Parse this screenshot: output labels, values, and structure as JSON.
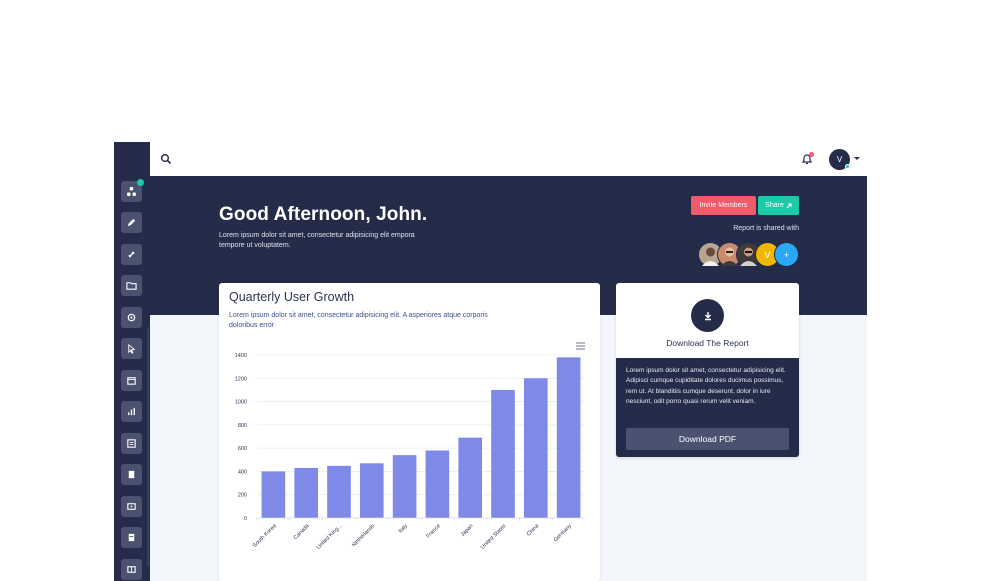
{
  "header": {
    "user_initial": "V"
  },
  "hero": {
    "greeting": "Good Afternoon, John.",
    "subtitle": "Lorem ipsum dolor sit amet, consectetur adipisicing elit empora tempore ut voluptatem.",
    "invite_label": "Invite Members",
    "share_label": "Share",
    "shared_with_label": "Report is shared with",
    "shared_avatars": [
      {
        "type": "photo",
        "color": "#b9a58f"
      },
      {
        "type": "photo",
        "color": "#c98b6e"
      },
      {
        "type": "photo",
        "color": "#3e3a3a"
      },
      {
        "type": "initial",
        "label": "V",
        "color": "#f2b705"
      },
      {
        "type": "add",
        "label": "+",
        "color": "#2aa7f5"
      }
    ]
  },
  "growth_card": {
    "title": "Quarterly User Growth",
    "subtitle": "Lorem ipsum dolor sit amet, consectetur adipisicing elit. A asperiores atque corporis doloribus error"
  },
  "chart_data": {
    "type": "bar",
    "categories": [
      "South Korea",
      "Canada",
      "United Kingdom",
      "Netherlands",
      "Italy",
      "France",
      "Japan",
      "United States",
      "China",
      "Germany"
    ],
    "category_labels": [
      "South Korea",
      "Canada",
      "United King...",
      "Netherlands",
      "Italy",
      "France",
      "Japan",
      "United States",
      "China",
      "Germany"
    ],
    "values": [
      400,
      430,
      448,
      470,
      540,
      580,
      690,
      1100,
      1200,
      1380
    ],
    "yticks": [
      0,
      200,
      400,
      600,
      800,
      1000,
      1200,
      1400
    ],
    "ylim": [
      0,
      1400
    ],
    "color": "#7f89e8",
    "grid": true
  },
  "download_card": {
    "title": "Download The Report",
    "body": "Lorem ipsum dolor sit amet, consectetur adipisicing elit. Adipisci cumque cupiditate dolores ducimus possimus, rem ut. At blanditiis cumque deserunt, dolor in iure nesciunt, odit porro quasi rerum velit veniam.",
    "button_label": "Download PDF"
  },
  "colors": {
    "navy": "#252c4a",
    "danger": "#f05a6a",
    "success": "#1dc9a6",
    "bar": "#7f89e8"
  }
}
